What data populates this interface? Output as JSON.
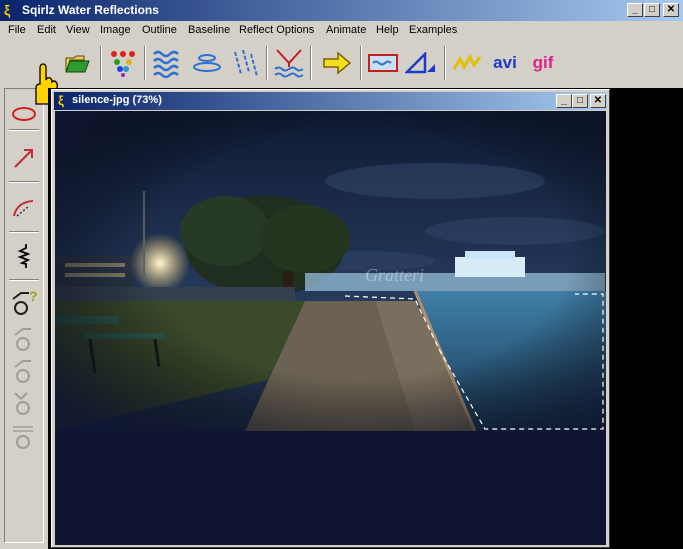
{
  "app": {
    "title": "Sqirlz Water Reflections"
  },
  "titlebar_buttons": {
    "minimize": "_",
    "maximize": "□",
    "close": "✕"
  },
  "menu": [
    "File",
    "Edit",
    "View",
    "Image",
    "Outline",
    "Baseline",
    "Reflect Options",
    "Animate",
    "Help",
    "Examples"
  ],
  "toolbar": {
    "open_icon": "folder-open-icon",
    "avi_label": "avi",
    "gif_label": "gif"
  },
  "document": {
    "title": "silence-jpg  (73%)",
    "watermark": "Gratteri"
  },
  "colors": {
    "title_gradient_start": "#0a246a",
    "title_gradient_end": "#a6caf0",
    "face": "#d4d0c8",
    "avi_color": "#1a3cc8",
    "gif_color": "#e0208c"
  }
}
